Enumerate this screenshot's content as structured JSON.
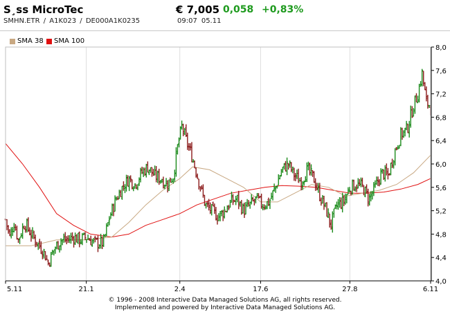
{
  "header": {
    "title": "S¸ss MicroTec",
    "ids": "SMHN.ETR   /   A1K023   /   DE000A1K0235",
    "price": "€ 7,005",
    "change": "0,058",
    "change_pct": "+0,83%",
    "time": "09:07",
    "date": "05.11"
  },
  "colors": {
    "up": "#1a8a1a",
    "down": "#8b1a1a",
    "sma38": "#c8a882",
    "sma100": "#e01010",
    "grid": "#dddddd",
    "positive": "#1e9a1e"
  },
  "legend": [
    {
      "label": "SMA 38",
      "color": "#c8a882"
    },
    {
      "label": "SMA 100",
      "color": "#e01010"
    }
  ],
  "chart_data": {
    "type": "ohlc",
    "x_ticks": [
      "5.11",
      "21.1",
      "2.4",
      "17.6",
      "27.8",
      "6.11"
    ],
    "y_ticks": [
      "8,0",
      "7,6",
      "7,2",
      "6,8",
      "6,4",
      "6,0",
      "5,6",
      "5,2",
      "4,8",
      "4,4",
      "4,0"
    ],
    "ylim": [
      4.0,
      8.0
    ],
    "grid": "vertical",
    "y_axis_position": "right",
    "legend_position": "top-left",
    "x_tick_positions": [
      0.0,
      0.19,
      0.41,
      0.6,
      0.81,
      1.0
    ],
    "price_path": [
      [
        0.0,
        5.05
      ],
      [
        0.01,
        4.75
      ],
      [
        0.02,
        5.0
      ],
      [
        0.03,
        4.7
      ],
      [
        0.045,
        5.0
      ],
      [
        0.06,
        4.8
      ],
      [
        0.075,
        4.65
      ],
      [
        0.09,
        4.5
      ],
      [
        0.1,
        4.3
      ],
      [
        0.115,
        4.55
      ],
      [
        0.13,
        4.7
      ],
      [
        0.145,
        4.7
      ],
      [
        0.16,
        4.75
      ],
      [
        0.175,
        4.7
      ],
      [
        0.19,
        4.75
      ],
      [
        0.21,
        4.65
      ],
      [
        0.23,
        4.65
      ],
      [
        0.245,
        5.1
      ],
      [
        0.26,
        5.4
      ],
      [
        0.275,
        5.6
      ],
      [
        0.29,
        5.75
      ],
      [
        0.305,
        5.65
      ],
      [
        0.32,
        5.85
      ],
      [
        0.335,
        5.95
      ],
      [
        0.35,
        5.8
      ],
      [
        0.365,
        5.75
      ],
      [
        0.38,
        5.65
      ],
      [
        0.395,
        5.8
      ],
      [
        0.405,
        6.3
      ],
      [
        0.415,
        6.65
      ],
      [
        0.425,
        6.4
      ],
      [
        0.44,
        6.1
      ],
      [
        0.455,
        5.7
      ],
      [
        0.47,
        5.3
      ],
      [
        0.485,
        5.2
      ],
      [
        0.5,
        5.1
      ],
      [
        0.515,
        5.2
      ],
      [
        0.53,
        5.35
      ],
      [
        0.545,
        5.4
      ],
      [
        0.56,
        5.2
      ],
      [
        0.575,
        5.3
      ],
      [
        0.59,
        5.4
      ],
      [
        0.605,
        5.3
      ],
      [
        0.62,
        5.35
      ],
      [
        0.635,
        5.6
      ],
      [
        0.65,
        5.9
      ],
      [
        0.665,
        6.0
      ],
      [
        0.68,
        5.8
      ],
      [
        0.695,
        5.7
      ],
      [
        0.71,
        5.9
      ],
      [
        0.725,
        5.75
      ],
      [
        0.74,
        5.45
      ],
      [
        0.755,
        5.2
      ],
      [
        0.765,
        4.95
      ],
      [
        0.78,
        5.3
      ],
      [
        0.795,
        5.35
      ],
      [
        0.81,
        5.6
      ],
      [
        0.825,
        5.65
      ],
      [
        0.84,
        5.6
      ],
      [
        0.855,
        5.4
      ],
      [
        0.87,
        5.6
      ],
      [
        0.885,
        5.85
      ],
      [
        0.9,
        5.8
      ],
      [
        0.915,
        6.2
      ],
      [
        0.93,
        6.5
      ],
      [
        0.945,
        6.6
      ],
      [
        0.96,
        7.0
      ],
      [
        0.97,
        7.2
      ],
      [
        0.98,
        7.55
      ],
      [
        0.99,
        7.05
      ],
      [
        1.0,
        7.0
      ]
    ],
    "sma38": [
      [
        0.0,
        4.6
      ],
      [
        0.06,
        4.6
      ],
      [
        0.12,
        4.7
      ],
      [
        0.19,
        4.7
      ],
      [
        0.25,
        4.75
      ],
      [
        0.29,
        5.0
      ],
      [
        0.33,
        5.3
      ],
      [
        0.37,
        5.55
      ],
      [
        0.41,
        5.75
      ],
      [
        0.44,
        5.95
      ],
      [
        0.48,
        5.9
      ],
      [
        0.52,
        5.75
      ],
      [
        0.56,
        5.6
      ],
      [
        0.6,
        5.35
      ],
      [
        0.64,
        5.35
      ],
      [
        0.68,
        5.5
      ],
      [
        0.72,
        5.65
      ],
      [
        0.76,
        5.6
      ],
      [
        0.8,
        5.45
      ],
      [
        0.84,
        5.5
      ],
      [
        0.88,
        5.55
      ],
      [
        0.92,
        5.65
      ],
      [
        0.96,
        5.85
      ],
      [
        1.0,
        6.15
      ]
    ],
    "sma100": [
      [
        0.0,
        6.35
      ],
      [
        0.04,
        6.0
      ],
      [
        0.08,
        5.6
      ],
      [
        0.12,
        5.15
      ],
      [
        0.16,
        4.95
      ],
      [
        0.2,
        4.8
      ],
      [
        0.25,
        4.75
      ],
      [
        0.29,
        4.8
      ],
      [
        0.33,
        4.95
      ],
      [
        0.37,
        5.05
      ],
      [
        0.41,
        5.15
      ],
      [
        0.45,
        5.3
      ],
      [
        0.49,
        5.4
      ],
      [
        0.53,
        5.5
      ],
      [
        0.57,
        5.55
      ],
      [
        0.61,
        5.6
      ],
      [
        0.65,
        5.63
      ],
      [
        0.69,
        5.62
      ],
      [
        0.73,
        5.6
      ],
      [
        0.77,
        5.55
      ],
      [
        0.81,
        5.5
      ],
      [
        0.85,
        5.5
      ],
      [
        0.89,
        5.52
      ],
      [
        0.93,
        5.57
      ],
      [
        0.97,
        5.65
      ],
      [
        1.0,
        5.75
      ]
    ]
  },
  "footer": {
    "line1": "© 1996 - 2008 Interactive Data Managed Solutions AG, all rights reserved.",
    "line2": "Implemented and powered by Interactive Data Managed Solutions AG."
  }
}
